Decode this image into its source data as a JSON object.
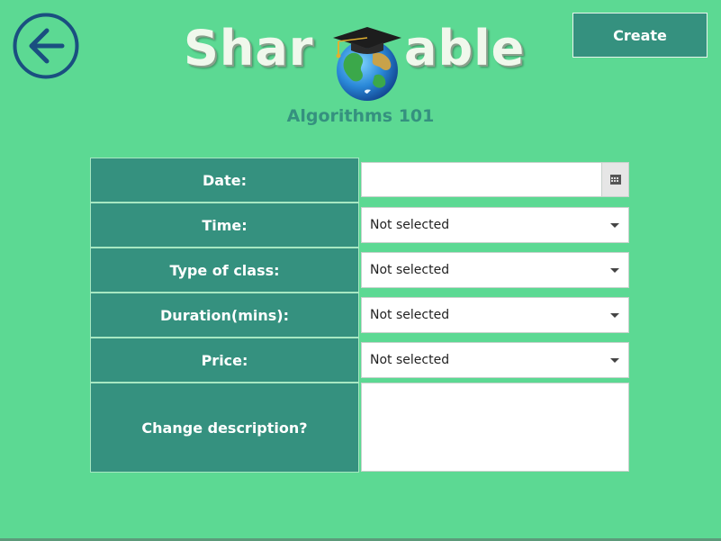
{
  "header": {
    "logo_text_left": "Shar",
    "logo_text_right": "able",
    "create_label": "Create",
    "course_title": "Algorithms 101"
  },
  "form": {
    "date": {
      "label": "Date:",
      "value": ""
    },
    "time": {
      "label": "Time:",
      "value": "Not selected"
    },
    "type": {
      "label": "Type of class:",
      "value": "Not selected"
    },
    "duration": {
      "label": "Duration(mins):",
      "value": "Not selected"
    },
    "price": {
      "label": "Price:",
      "value": "Not selected"
    },
    "description": {
      "label": "Change description?",
      "value": ""
    }
  },
  "icons": {
    "back": "arrow-left-circle-icon",
    "calendar": "calendar-icon",
    "dropdown": "chevron-down-icon",
    "logo": "globe-graduation-cap-icon"
  },
  "colors": {
    "background": "#5cd993",
    "accent": "#35917f",
    "back_icon": "#1a4f80"
  }
}
